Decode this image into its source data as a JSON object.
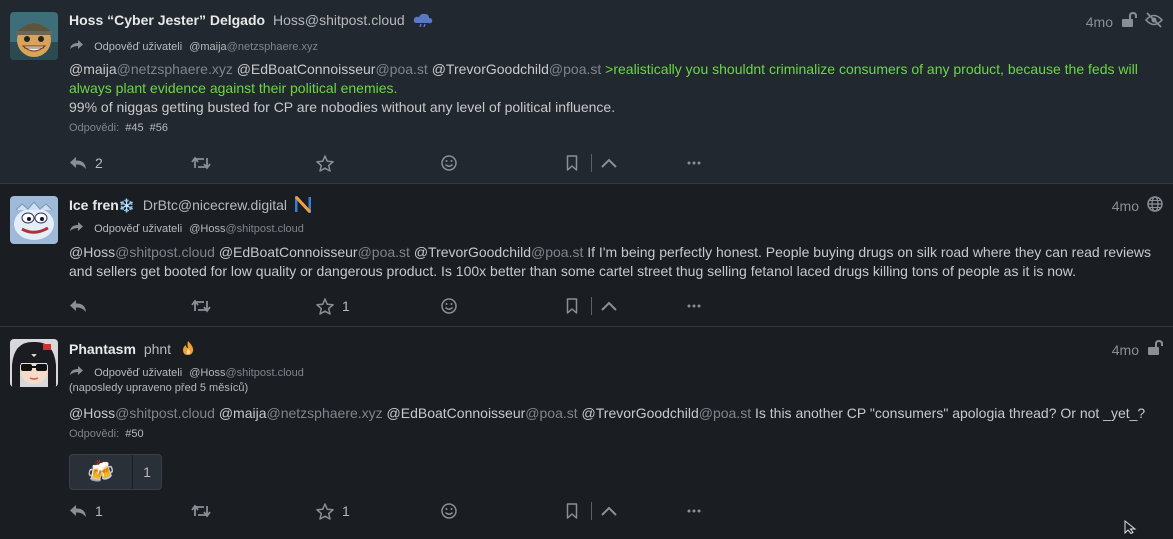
{
  "colors": {
    "background": "#1a1e23",
    "highlight_post": "#212830",
    "greentext": "#6dd645",
    "muted": "#7f858b"
  },
  "posts": [
    {
      "author_name": "Hoss “Cyber Jester” Delgado",
      "author_handle": "Hoss@shitpost.cloud",
      "badge_icon": "cloud-icon",
      "time": "4mo",
      "visibility_icons": [
        "unlock-icon",
        "eye-slash-icon"
      ],
      "reply_label": "Odpověď uživateli",
      "reply_to_user": "@maija",
      "reply_to_domain": "@netzsphaere.xyz",
      "mentions": [
        {
          "user": "@maija",
          "domain": "@netzsphaere.xyz"
        },
        {
          "user": "@EdBoatConnoisseur",
          "domain": "@poa.st"
        },
        {
          "user": "@TrevorGoodchild",
          "domain": "@poa.st"
        }
      ],
      "greentext": ">realistically you shouldnt criminalize consumers of any product, because the feds will always plant evidence against their political enemies.",
      "text_line2": "99% of niggas getting busted for CP are nobodies without any level of political influence.",
      "replies_label": "Odpovědi:",
      "replies": [
        "#45",
        "#56"
      ],
      "counts": {
        "reply": "2",
        "repeat": "",
        "favorite": ""
      }
    },
    {
      "author_name": "Ice fren",
      "name_emoji": "❄️",
      "author_handle": "DrBtc@nicecrew.digital",
      "badge_icon": "n-logo-icon",
      "time": "4mo",
      "visibility_icons": [
        "globe-icon"
      ],
      "reply_label": "Odpověď uživateli",
      "reply_to_user": "@Hoss",
      "reply_to_domain": "@shitpost.cloud",
      "mentions": [
        {
          "user": "@Hoss",
          "domain": "@shitpost.cloud"
        },
        {
          "user": "@EdBoatConnoisseur",
          "domain": "@poa.st"
        },
        {
          "user": "@TrevorGoodchild",
          "domain": "@poa.st"
        }
      ],
      "text": "If I'm being perfectly honest.  People buying drugs on silk road where they can read reviews and sellers get booted for low quality or dangerous product.  Is 100x better than some cartel street thug selling fetanol laced drugs killing tons of people as it is now.",
      "counts": {
        "reply": "",
        "repeat": "",
        "favorite": "1"
      }
    },
    {
      "author_name": "Phantasm",
      "author_handle": "phnt",
      "badge_icon": "flame-icon",
      "time": "4mo",
      "visibility_icons": [
        "unlock-icon"
      ],
      "reply_label": "Odpověď uživateli",
      "reply_to_user": "@Hoss",
      "reply_to_domain": "@shitpost.cloud",
      "edited": "(naposledy upraveno před 5 měsíců)",
      "mentions": [
        {
          "user": "@Hoss",
          "domain": "@shitpost.cloud"
        },
        {
          "user": "@maija",
          "domain": "@netzsphaere.xyz"
        },
        {
          "user": "@EdBoatConnoisseur",
          "domain": "@poa.st"
        },
        {
          "user": "@TrevorGoodchild",
          "domain": "@poa.st"
        }
      ],
      "text": "Is this another CP \"consumers\" apologia thread? Or not _yet_?",
      "replies_label": "Odpovědi:",
      "replies": [
        "#50"
      ],
      "reaction": {
        "emoji": "🍻",
        "count": "1"
      },
      "counts": {
        "reply": "1",
        "repeat": "",
        "favorite": "1"
      }
    }
  ]
}
